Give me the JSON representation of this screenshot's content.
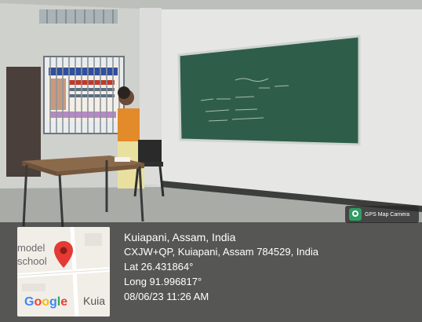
{
  "badge": {
    "icon": "gps-map-camera-icon",
    "label": "GPS Map Camera"
  },
  "map": {
    "label_line1": "model",
    "label_line2": "school",
    "label_side": "Kuia",
    "logo": [
      "G",
      "o",
      "o",
      "g",
      "l",
      "e"
    ],
    "logo_colors": [
      "#4285F4",
      "#EA4335",
      "#FBBC05",
      "#4285F4",
      "#34A853",
      "#EA4335"
    ],
    "pin_color": "#e53935"
  },
  "location": {
    "place": "Kuiapani, Assam, India",
    "address": "CXJW+QP, Kuiapani, Assam 784529, India",
    "latitude": "Lat 26.431864°",
    "longitude": "Long 91.996817°",
    "datetime": "08/06/23 11:26 AM"
  }
}
